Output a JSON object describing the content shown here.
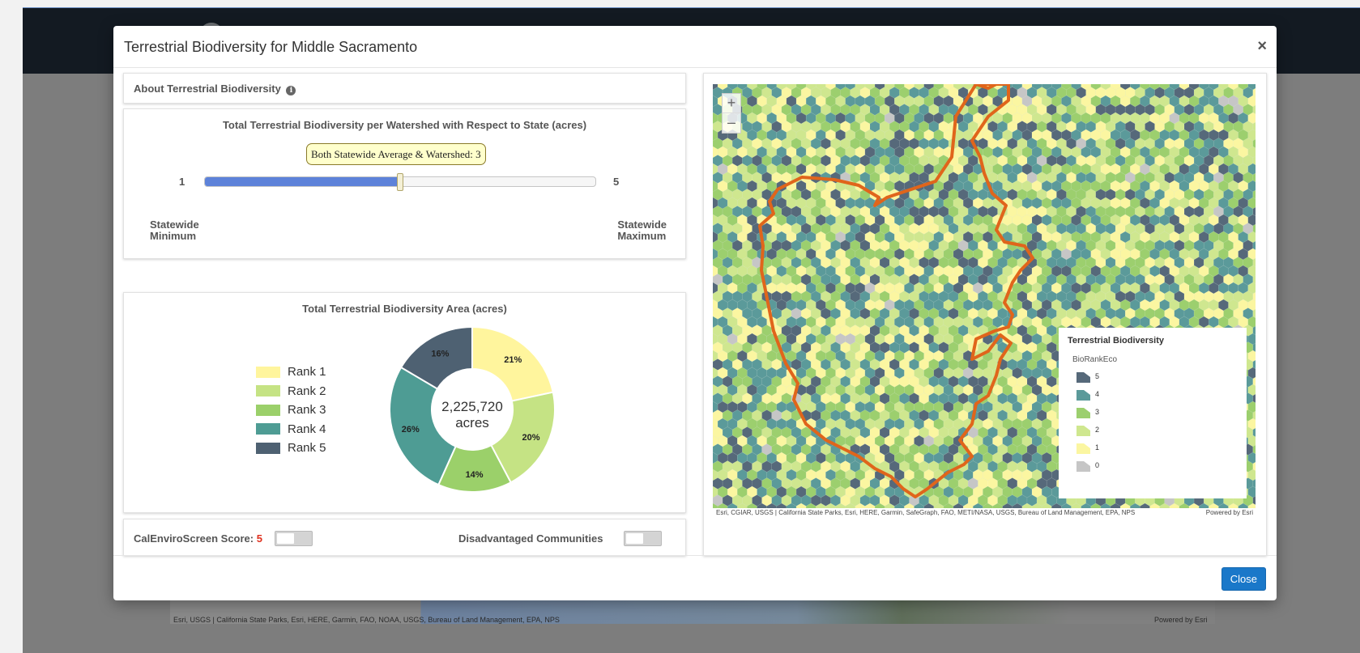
{
  "background": {
    "map_attribution": "Esri, USGS | California State Parks, Esri, HERE, Garmin, FAO, NOAA, USGS, Bureau of Land Management, EPA, NPS",
    "powered_by": "Powered by Esri"
  },
  "modal": {
    "title": "Terrestrial Biodiversity for Middle Sacramento",
    "close_x": "×",
    "close_button": "Close"
  },
  "about": {
    "label": "About Terrestrial Biodiversity",
    "info_icon": "info-circle-icon"
  },
  "slider": {
    "title": "Total Terrestrial Biodiversity per Watershed with Respect to State (acres)",
    "tooltip": "Both Statewide Average & Watershed: 3",
    "min_value": "1",
    "max_value": "5",
    "value": 3,
    "fill_color": "#5d82d9",
    "min_label_line1": "Statewide",
    "min_label_line2": "Minimum",
    "max_label_line1": "Statewide",
    "max_label_line2": "Maximum"
  },
  "donut": {
    "title": "Total Terrestrial Biodiversity Area (acres)",
    "center_value": "2,225,720",
    "center_unit": "acres"
  },
  "chart_data": {
    "type": "pie",
    "title": "Total Terrestrial Biodiversity Area (acres)",
    "categories": [
      "Rank 1",
      "Rank 2",
      "Rank 3",
      "Rank 4",
      "Rank 5"
    ],
    "values": [
      21,
      20,
      14,
      26,
      16
    ],
    "labels": [
      "21%",
      "20%",
      "14%",
      "26%",
      "16%"
    ],
    "colors": [
      "#fff59d",
      "#c5e384",
      "#9bd06a",
      "#4e9c94",
      "#4e6172"
    ],
    "legend": "left",
    "donut": true,
    "center_text": "2,225,720 acres"
  },
  "toggles": {
    "calenviro_label": "CalEnviroScreen Score:",
    "calenviro_score": "5",
    "dac_label": "Disadvantaged Communities"
  },
  "map": {
    "zoom_in": "+",
    "zoom_out": "–",
    "attribution": "Esri, CGIAR, USGS | California State Parks, Esri, HERE, Garmin, SafeGraph, FAO, METI/NASA, USGS, Bureau of Land Management, EPA, NPS",
    "powered_by": "Powered by Esri",
    "watershed_outline_color": "#e0651b",
    "legend": {
      "title": "Terrestrial Biodiversity",
      "field": "BioRankEco",
      "items": [
        {
          "label": "5",
          "color": "#56697a"
        },
        {
          "label": "4",
          "color": "#5b9a9a"
        },
        {
          "label": "3",
          "color": "#9ccf6e"
        },
        {
          "label": "2",
          "color": "#cfe78f"
        },
        {
          "label": "1",
          "color": "#fbf6a1"
        },
        {
          "label": "0",
          "color": "#c6c6c6"
        }
      ]
    }
  }
}
